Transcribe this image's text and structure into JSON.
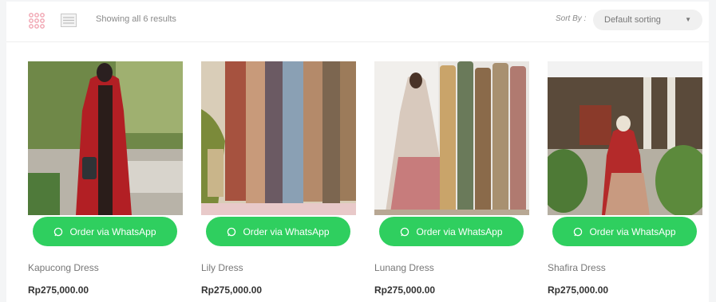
{
  "toolbar": {
    "grid_icon": "grid-view-icon",
    "list_icon": "list-view-icon",
    "result_count": "Showing all 6 results",
    "sort_label": "Sort By :",
    "sort_value": "Default sorting"
  },
  "colors": {
    "accent_pink": "#f0a3b0",
    "whatsapp_green": "#2fcf5f"
  },
  "products": [
    {
      "name": "Kapucong Dress",
      "price": "Rp275,000.00",
      "button": "Order via WhatsApp",
      "button_icon": "whatsapp-icon"
    },
    {
      "name": "Lily Dress",
      "price": "Rp275,000.00",
      "button": "Order via WhatsApp",
      "button_icon": "whatsapp-icon"
    },
    {
      "name": "Lunang Dress",
      "price": "Rp275,000.00",
      "button": "Order via WhatsApp",
      "button_icon": "whatsapp-icon"
    },
    {
      "name": "Shafira Dress",
      "price": "Rp275,000.00",
      "button": "Order via WhatsApp",
      "button_icon": "whatsapp-icon"
    }
  ]
}
